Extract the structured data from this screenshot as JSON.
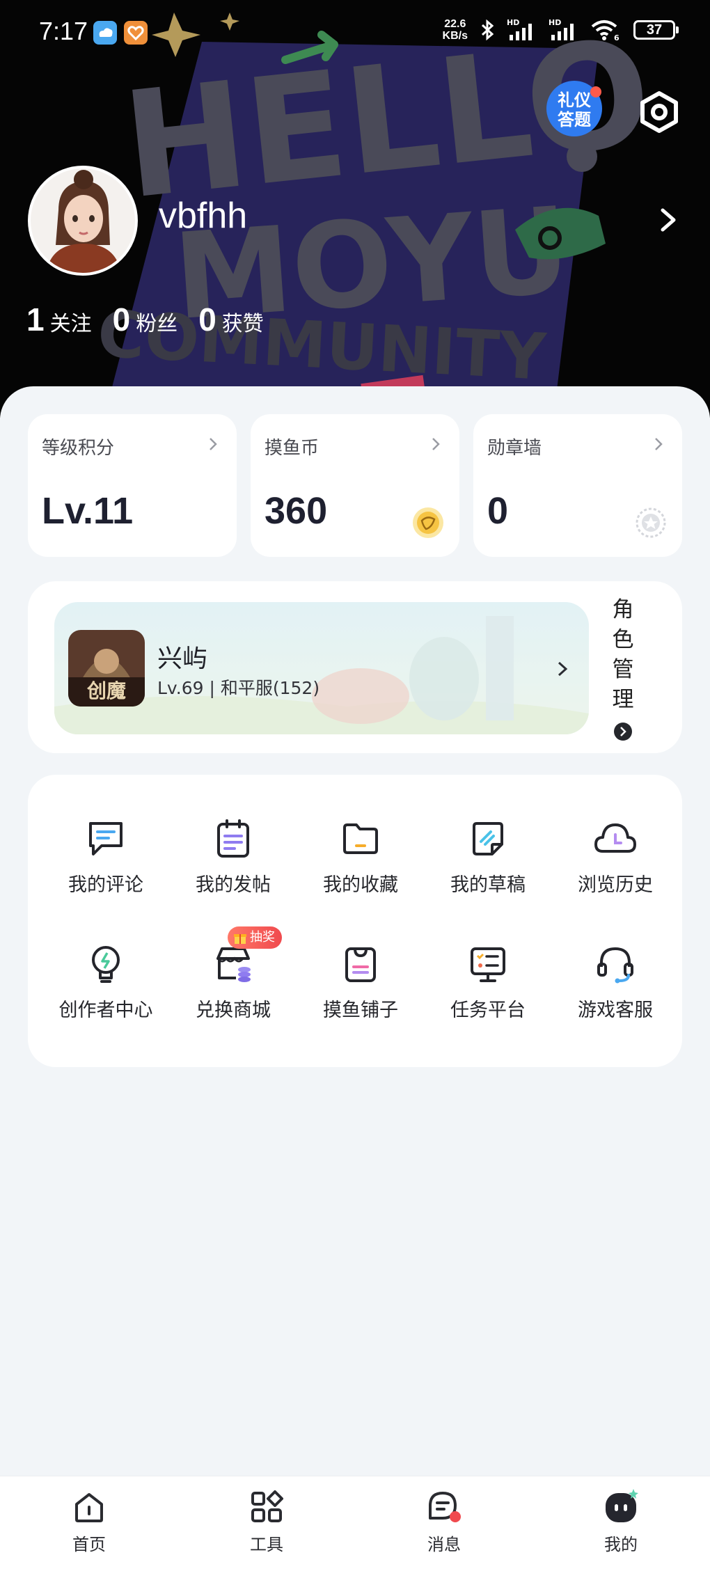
{
  "status_bar": {
    "time": "7:17",
    "net_speed_value": "22.6",
    "net_speed_unit": "KB/s",
    "battery": "37",
    "icons": [
      "weather-app-icon",
      "heart-app-icon",
      "bluetooth-icon",
      "signal-hd-icon",
      "signal-hd-icon",
      "wifi-6-icon",
      "battery-icon"
    ]
  },
  "header": {
    "quiz_badge_line1": "礼仪",
    "quiz_badge_line2": "答题",
    "username": "vbfhh",
    "social": [
      {
        "count": "1",
        "label": "关注"
      },
      {
        "count": "0",
        "label": "粉丝"
      },
      {
        "count": "0",
        "label": "获赞"
      }
    ]
  },
  "stats": [
    {
      "title": "等级积分",
      "value": "Lv.11"
    },
    {
      "title": "摸鱼币",
      "value": "360",
      "icon": "coin-icon"
    },
    {
      "title": "勋章墙",
      "value": "0",
      "icon": "medal-icon"
    }
  ],
  "role": {
    "game_icon_text": "创魔",
    "name": "兴屿",
    "info": "Lv.69 | 和平服(152)",
    "manage_label": "角色管理"
  },
  "menu": [
    {
      "label": "我的评论",
      "icon": "comment-icon"
    },
    {
      "label": "我的发帖",
      "icon": "post-icon"
    },
    {
      "label": "我的收藏",
      "icon": "folder-icon"
    },
    {
      "label": "我的草稿",
      "icon": "draft-icon"
    },
    {
      "label": "浏览历史",
      "icon": "history-icon"
    },
    {
      "label": "创作者中心",
      "icon": "bulb-icon"
    },
    {
      "label": "兑换商城",
      "icon": "shop-icon",
      "badge": "抽奖"
    },
    {
      "label": "摸鱼铺子",
      "icon": "bag-icon"
    },
    {
      "label": "任务平台",
      "icon": "task-icon"
    },
    {
      "label": "游戏客服",
      "icon": "headset-icon"
    }
  ],
  "tabs": [
    {
      "label": "首页",
      "icon": "home-icon"
    },
    {
      "label": "工具",
      "icon": "tools-icon"
    },
    {
      "label": "消息",
      "icon": "message-icon"
    },
    {
      "label": "我的",
      "icon": "profile-icon",
      "active": true
    }
  ],
  "colors": {
    "accent_blue": "#4aa8f0",
    "accent_purple": "#8f7cf0",
    "accent_orange": "#f6ad2a",
    "badge_red": "#f04a4e",
    "header_bg": "#050505"
  }
}
